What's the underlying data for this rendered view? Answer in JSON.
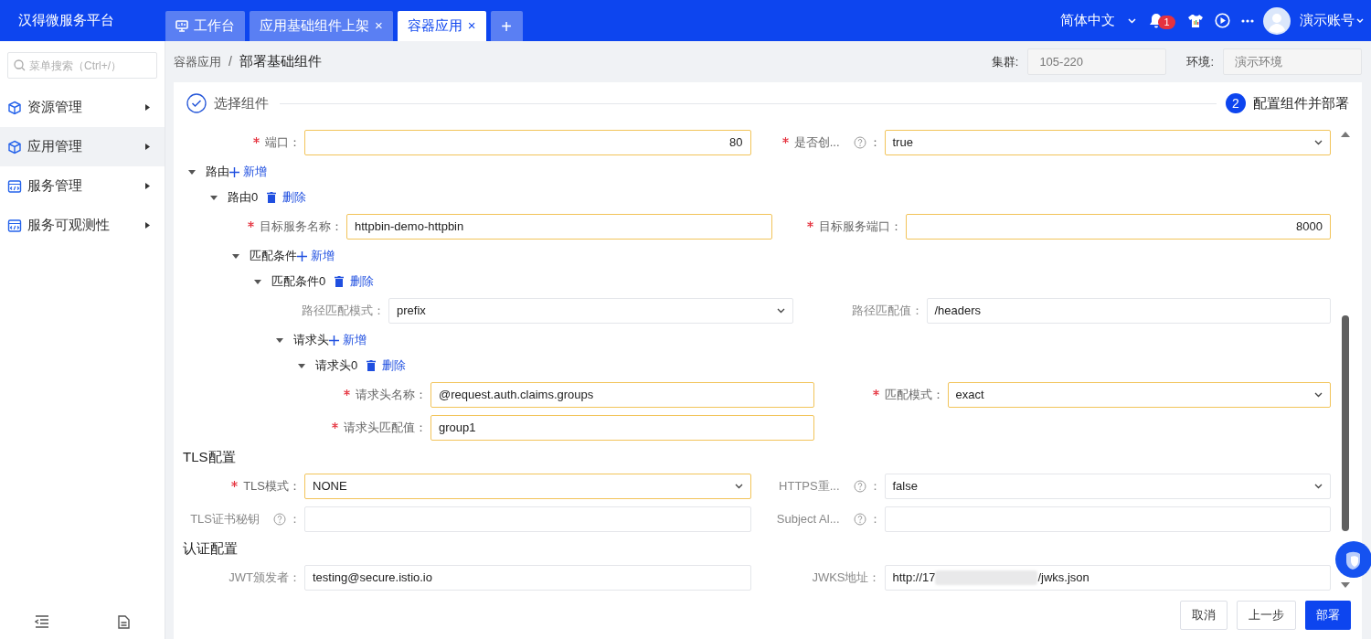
{
  "header": {
    "title": "汉得微服务平台",
    "tabs": [
      {
        "kind": "home",
        "label": "工作台",
        "closable": false,
        "selected": false
      },
      {
        "kind": "page",
        "label": "应用基础组件上架",
        "closable": true,
        "selected": false
      },
      {
        "kind": "page",
        "label": "容器应用",
        "closable": true,
        "selected": true
      }
    ],
    "close_glyph": "×",
    "add_tab": "+",
    "language": "简体中文",
    "notifications": "1",
    "user": "演示账号"
  },
  "sidebar": {
    "search_placeholder": "菜单搜索（Ctrl+/）",
    "items": [
      {
        "label": "资源管理",
        "selected": false
      },
      {
        "label": "应用管理",
        "selected": true
      },
      {
        "label": "服务管理",
        "selected": false
      },
      {
        "label": "服务可观测性",
        "selected": false
      }
    ]
  },
  "breadcrumb": [
    "容器应用",
    "部署基础组件"
  ],
  "breadcrumb_separator": "/",
  "filters": [
    {
      "label": "集群:",
      "value": "105-220",
      "disabled": true
    },
    {
      "label": "环境:",
      "value": "演示环境",
      "disabled": true
    }
  ],
  "steps": [
    {
      "title": "选择组件",
      "kind": "done"
    },
    {
      "number": "2",
      "title": "配置组件并部署",
      "kind": "current"
    }
  ],
  "form": [
    {
      "kind": "fields",
      "fields": [
        {
          "label": "端口",
          "required": true,
          "help": false,
          "kind": "number",
          "value": "80",
          "colon": "："
        },
        {
          "label": "是否创...",
          "required": true,
          "help": true,
          "kind": "select",
          "value": "true",
          "colon": "："
        }
      ]
    },
    {
      "kind": "node",
      "label": "路由",
      "action": {
        "kind": "add",
        "label": "新增"
      },
      "expanded": true,
      "children": [
        {
          "kind": "node",
          "label": "路由0",
          "action": {
            "kind": "delete",
            "label": "删除"
          },
          "expanded": true,
          "children": [
            {
              "kind": "fields",
              "fields": [
                {
                  "label": "目标服务名称",
                  "required": true,
                  "help": false,
                  "kind": "input",
                  "value": "httpbin-demo-httpbin",
                  "colon": "："
                },
                {
                  "label": "目标服务端口",
                  "required": true,
                  "help": false,
                  "kind": "number",
                  "value": "8000",
                  "colon": "："
                }
              ]
            },
            {
              "kind": "node",
              "label": "匹配条件",
              "action": {
                "kind": "add",
                "label": "新增"
              },
              "expanded": true,
              "children": [
                {
                  "kind": "node",
                  "label": "匹配条件0",
                  "action": {
                    "kind": "delete",
                    "label": "删除"
                  },
                  "expanded": true,
                  "children": [
                    {
                      "kind": "fields",
                      "fields": [
                        {
                          "label": "路径匹配模式",
                          "required": false,
                          "help": false,
                          "kind": "select",
                          "value": "prefix",
                          "colon": "："
                        },
                        {
                          "label": "路径匹配值",
                          "required": false,
                          "help": false,
                          "kind": "input",
                          "value": "/headers",
                          "colon": "："
                        }
                      ]
                    },
                    {
                      "kind": "node",
                      "label": "请求头",
                      "action": {
                        "kind": "add",
                        "label": "新增"
                      },
                      "expanded": true,
                      "children": [
                        {
                          "kind": "node",
                          "label": "请求头0",
                          "action": {
                            "kind": "delete",
                            "label": "删除"
                          },
                          "expanded": true,
                          "children": [
                            {
                              "kind": "fields",
                              "fields": [
                                {
                                  "label": "请求头名称",
                                  "required": true,
                                  "help": false,
                                  "kind": "input",
                                  "value": "@request.auth.claims.groups",
                                  "colon": "："
                                },
                                {
                                  "label": "匹配模式",
                                  "required": true,
                                  "help": false,
                                  "kind": "select",
                                  "value": "exact",
                                  "colon": "："
                                }
                              ]
                            },
                            {
                              "kind": "fields",
                              "fields": [
                                {
                                  "label": "请求头匹配值",
                                  "required": true,
                                  "help": false,
                                  "kind": "input",
                                  "value": "group1",
                                  "colon": "："
                                }
                              ]
                            }
                          ]
                        }
                      ]
                    }
                  ]
                }
              ]
            }
          ]
        }
      ]
    },
    {
      "kind": "heading",
      "text": "TLS配置"
    },
    {
      "kind": "fields",
      "fields": [
        {
          "label": "TLS模式",
          "required": true,
          "help": false,
          "kind": "select",
          "value": "NONE",
          "colon": "："
        },
        {
          "label": "HTTPS重...",
          "required": false,
          "help": true,
          "kind": "select",
          "value": "false",
          "colon": "："
        }
      ]
    },
    {
      "kind": "fields",
      "fields": [
        {
          "label": "TLS证书秘钥",
          "required": false,
          "help": true,
          "kind": "input",
          "colon": "："
        },
        {
          "label": "Subject Al...",
          "required": false,
          "help": true,
          "kind": "input",
          "colon": "："
        }
      ]
    },
    {
      "kind": "heading",
      "text": "认证配置"
    },
    {
      "kind": "fields",
      "fields": [
        {
          "label": "JWT颁发者",
          "required": false,
          "help": false,
          "kind": "input",
          "value": "testing@secure.istio.io",
          "colon": "："
        },
        {
          "label": "JWKS地址",
          "required": false,
          "help": false,
          "kind": "input",
          "value": "http://17",
          "value_after_redaction": "/jwks.json",
          "colon": "："
        }
      ]
    }
  ],
  "buttons": [
    {
      "label": "取消",
      "kind": "default"
    },
    {
      "label": "上一步",
      "kind": "default"
    },
    {
      "label": "部署",
      "kind": "primary"
    }
  ]
}
